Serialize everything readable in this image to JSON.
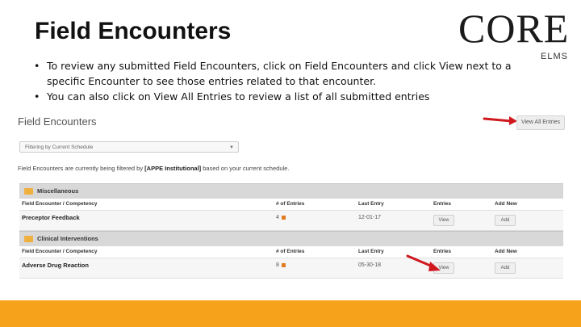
{
  "slide": {
    "title": "Field Encounters",
    "logo": "CORE",
    "logo_sub": "ELMS",
    "bullets": [
      "To review any submitted Field Encounters, click on Field Encounters and click View next to a specific Encounter to see those entries related to that encounter.",
      "You can also click on View All Entries to review a list of all submitted entries"
    ]
  },
  "app": {
    "title": "Field Encounters",
    "view_all_label": "View All Entries",
    "filter_value": "Filtering by Current Schedule",
    "filter_note_prefix": "Field Encounters are currently being filtered by ",
    "filter_note_bold": "[APPE Institutional]",
    "filter_note_suffix": " based on your current schedule.",
    "columns": [
      "Field Encounter / Competency",
      "# of Entries",
      "Last Entry",
      "Entries",
      "Add New"
    ],
    "categories": [
      {
        "name": "Miscellaneous",
        "rows": [
          {
            "name": "Preceptor Feedback",
            "entries": "4",
            "last_entry": "12-01-17",
            "view": "View",
            "add": "Add"
          }
        ]
      },
      {
        "name": "Clinical Interventions",
        "rows": [
          {
            "name": "Adverse Drug Reaction",
            "entries": "8",
            "last_entry": "05-30-18",
            "view": "View",
            "add": "Add"
          }
        ]
      }
    ]
  },
  "colors": {
    "accent_bar": "#f7a21b",
    "arrow": "#d0181f",
    "folder": "#f0b040"
  }
}
